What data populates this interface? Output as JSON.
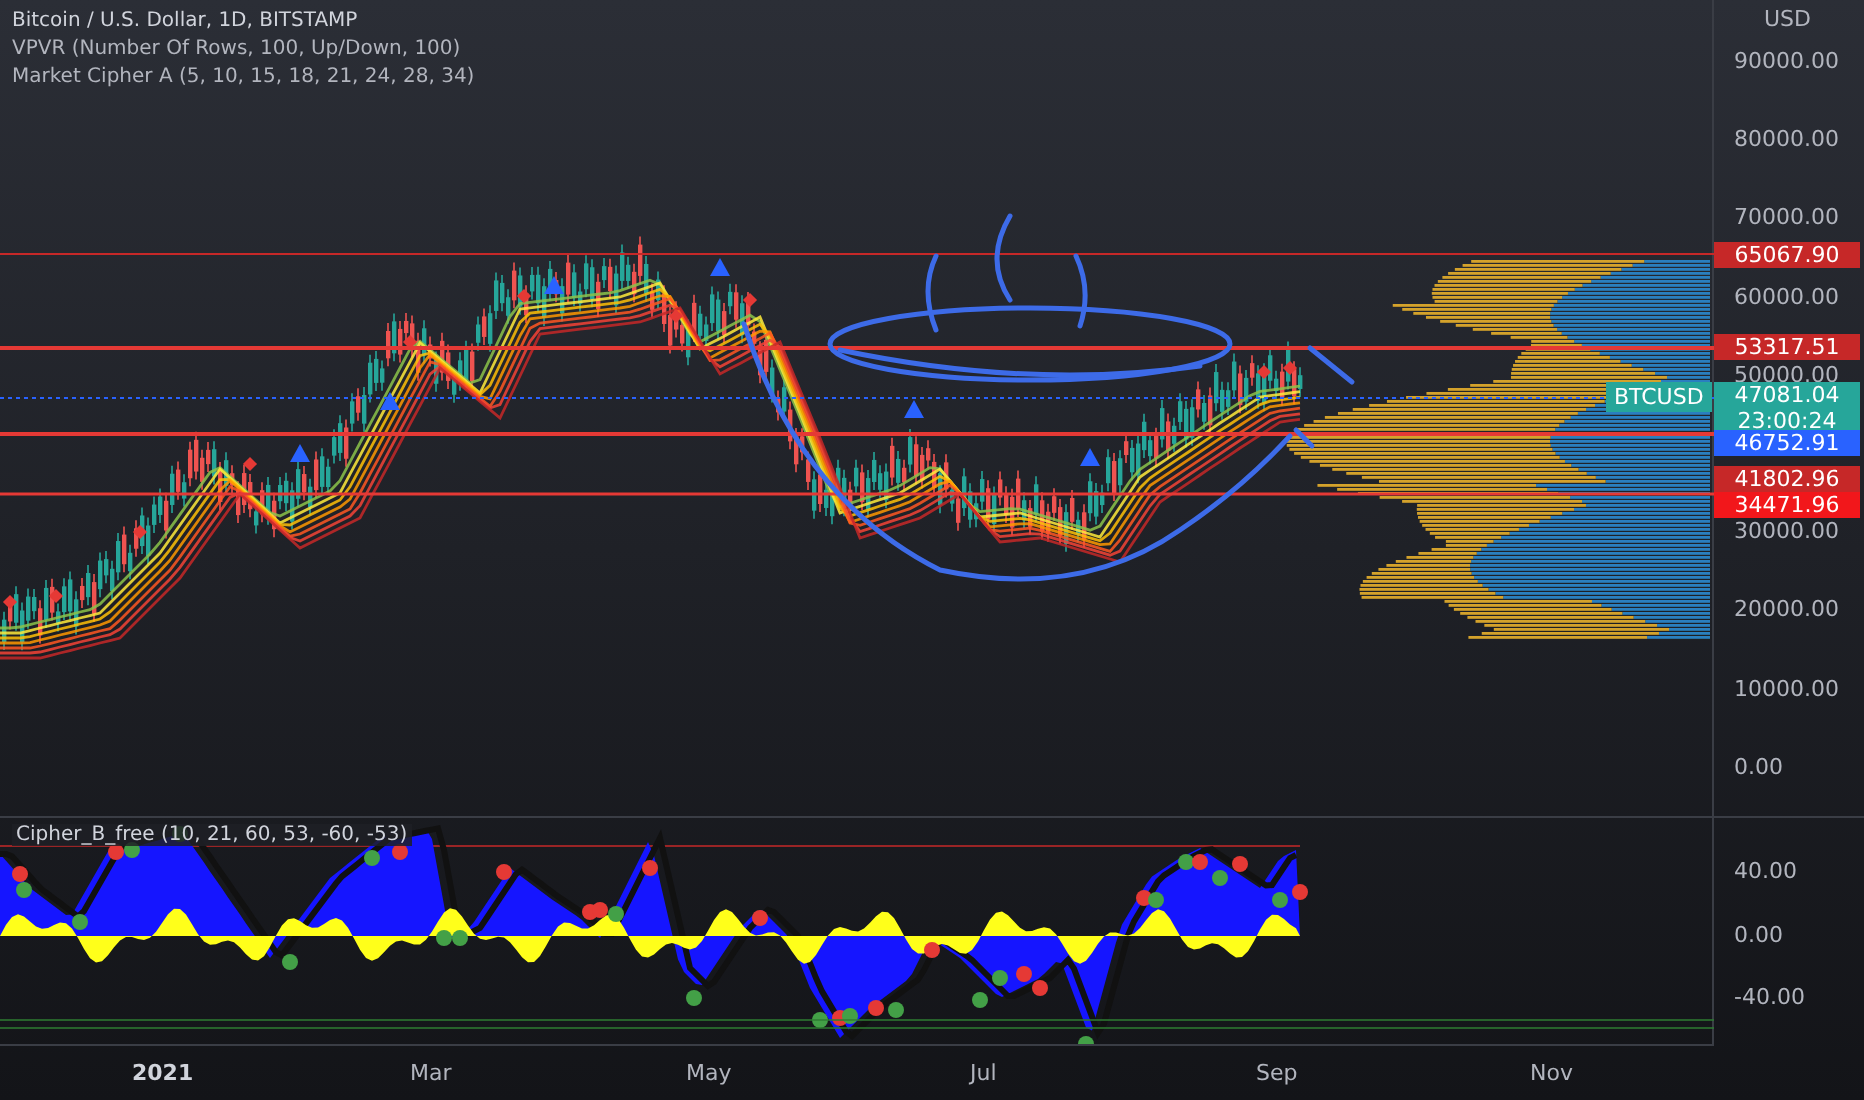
{
  "legend": [
    "Bitcoin / U.S. Dollar, 1D, BITSTAMP",
    "VPVR (Number Of Rows, 100, Up/Down, 100)",
    "Market Cipher A (5, 10, 15, 18, 21, 24, 28, 34)"
  ],
  "price_axis": {
    "currency": "USD",
    "ticks": [
      "90000.00",
      "80000.00",
      "70000.00",
      "60000.00",
      "50000.00",
      "30000.00",
      "20000.00",
      "10000.00",
      "0.00"
    ],
    "labels": [
      {
        "value": "65067.90",
        "color": "#c62828"
      },
      {
        "value": "53317.51",
        "color": "#c62828"
      },
      {
        "value": "47081.04",
        "countdown": "23:00:24",
        "color": "#26a69a"
      },
      {
        "value": "46752.91",
        "color": "#2962ff"
      },
      {
        "value": "41802.96",
        "color": "#c62828"
      },
      {
        "value": "34471.96",
        "color": "#f2171b"
      }
    ]
  },
  "symbol_badge": "BTCUSD",
  "oscillator": {
    "legend": "Cipher_B_free (10, 21, 60, 53, -60, -53)",
    "ticks": [
      "40.00",
      "0.00",
      "-40.00"
    ]
  },
  "time_axis": [
    "2021",
    "Mar",
    "May",
    "Jul",
    "Sep",
    "Nov"
  ]
}
